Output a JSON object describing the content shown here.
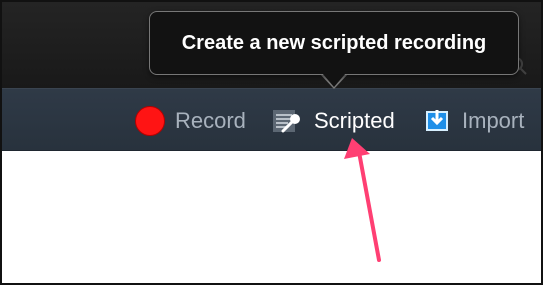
{
  "tooltip": {
    "text": "Create a new scripted recording"
  },
  "toolbar": {
    "record_label": "Record",
    "scripted_label": "Scripted",
    "import_label": "Import"
  },
  "colors": {
    "record": "#ff1414",
    "toolbar_bg": "#2f3a47",
    "tooltip_bg": "#121212",
    "arrow": "#ff3f73",
    "import_icon": "#38a7ff"
  },
  "icons": {
    "record": "record-icon",
    "scripted": "script-microphone-icon",
    "import": "import-icon",
    "arrow": "pointer-arrow-icon"
  }
}
